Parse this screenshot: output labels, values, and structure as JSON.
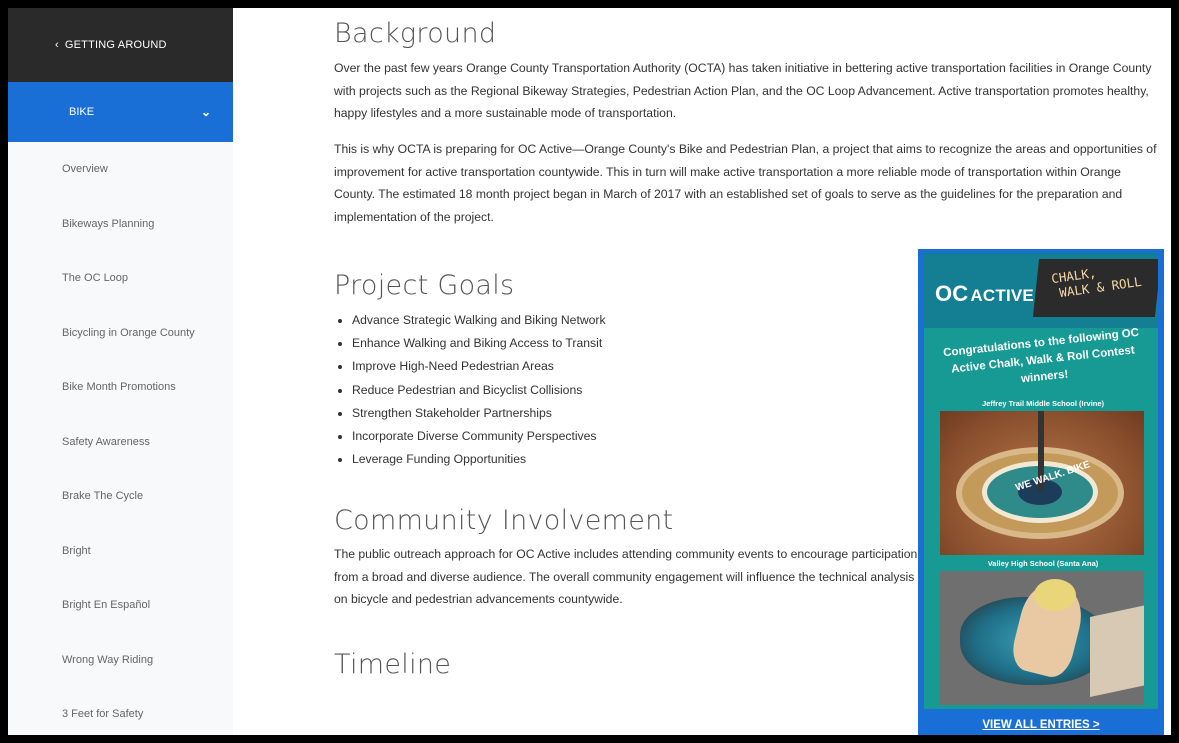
{
  "sidebar": {
    "back_label": "GETTING AROUND",
    "section_label": "BIKE",
    "items": [
      {
        "label": "Overview"
      },
      {
        "label": "Bikeways Planning"
      },
      {
        "label": "The OC Loop"
      },
      {
        "label": "Bicycling in Orange County"
      },
      {
        "label": "Bike Month Promotions"
      },
      {
        "label": "Safety Awareness"
      },
      {
        "label": "Brake The Cycle"
      },
      {
        "label": "Bright"
      },
      {
        "label": "Bright En Español"
      },
      {
        "label": "Wrong Way Riding"
      },
      {
        "label": "3 Feet for Safety"
      }
    ]
  },
  "main": {
    "background": {
      "title": "Background",
      "p1": "Over the past few years Orange County Transportation Authority (OCTA) has taken initiative in bettering active transportation facilities in Orange County with projects such as the Regional Bikeway Strategies, Pedestrian Action Plan, and the OC Loop Advancement. Active transportation promotes healthy, happy lifestyles and a more sustainable mode of transportation.",
      "p2": "This is why OCTA is preparing for OC Active—Orange County's Bike and Pedestrian Plan, a project that aims to recognize the areas and opportunities of improvement for active transportation countywide. This in turn will make active transportation a more reliable mode of transportation within Orange County. The estimated 18 month project began in March of 2017 with an established set of goals to serve as the guidelines for the preparation and implementation of the project."
    },
    "goals": {
      "title": "Project Goals",
      "items": [
        "Advance Strategic Walking and Biking Network",
        "Enhance Walking and Biking Access to Transit",
        "Improve High-Need Pedestrian Areas",
        "Reduce Pedestrian and Bicyclist Collisions",
        "Strengthen Stakeholder Partnerships",
        "Incorporate Diverse Community Perspectives",
        "Leverage Funding Opportunities"
      ]
    },
    "community": {
      "title": "Community Involvement",
      "p": "The public outreach approach for OC Active includes attending community events to encourage participation from a broad and diverse audience. The overall community engagement will influence the technical analysis on bicycle and pedestrian advancements countywide."
    },
    "timeline": {
      "title": "Timeline"
    }
  },
  "promo": {
    "logo_prefix": "OC",
    "logo_word": "ACTIVE",
    "chalk_line1": "CHALK,",
    "chalk_line2": "WALK & ROLL",
    "congrats": "Congratulations to the following OC Active Chalk, Walk & Roll Contest winners!",
    "school1": "Jeffrey Trail Middle School (Irvine)",
    "photo1_text": "WE WALK. BIKE",
    "school2": "Valley High School (Santa Ana)",
    "view_all": "VIEW ALL ENTRIES >"
  },
  "colors": {
    "sidebar_dark": "#2a2a2a",
    "accent_blue": "#1a6fd6",
    "promo_teal": "#169a93"
  }
}
